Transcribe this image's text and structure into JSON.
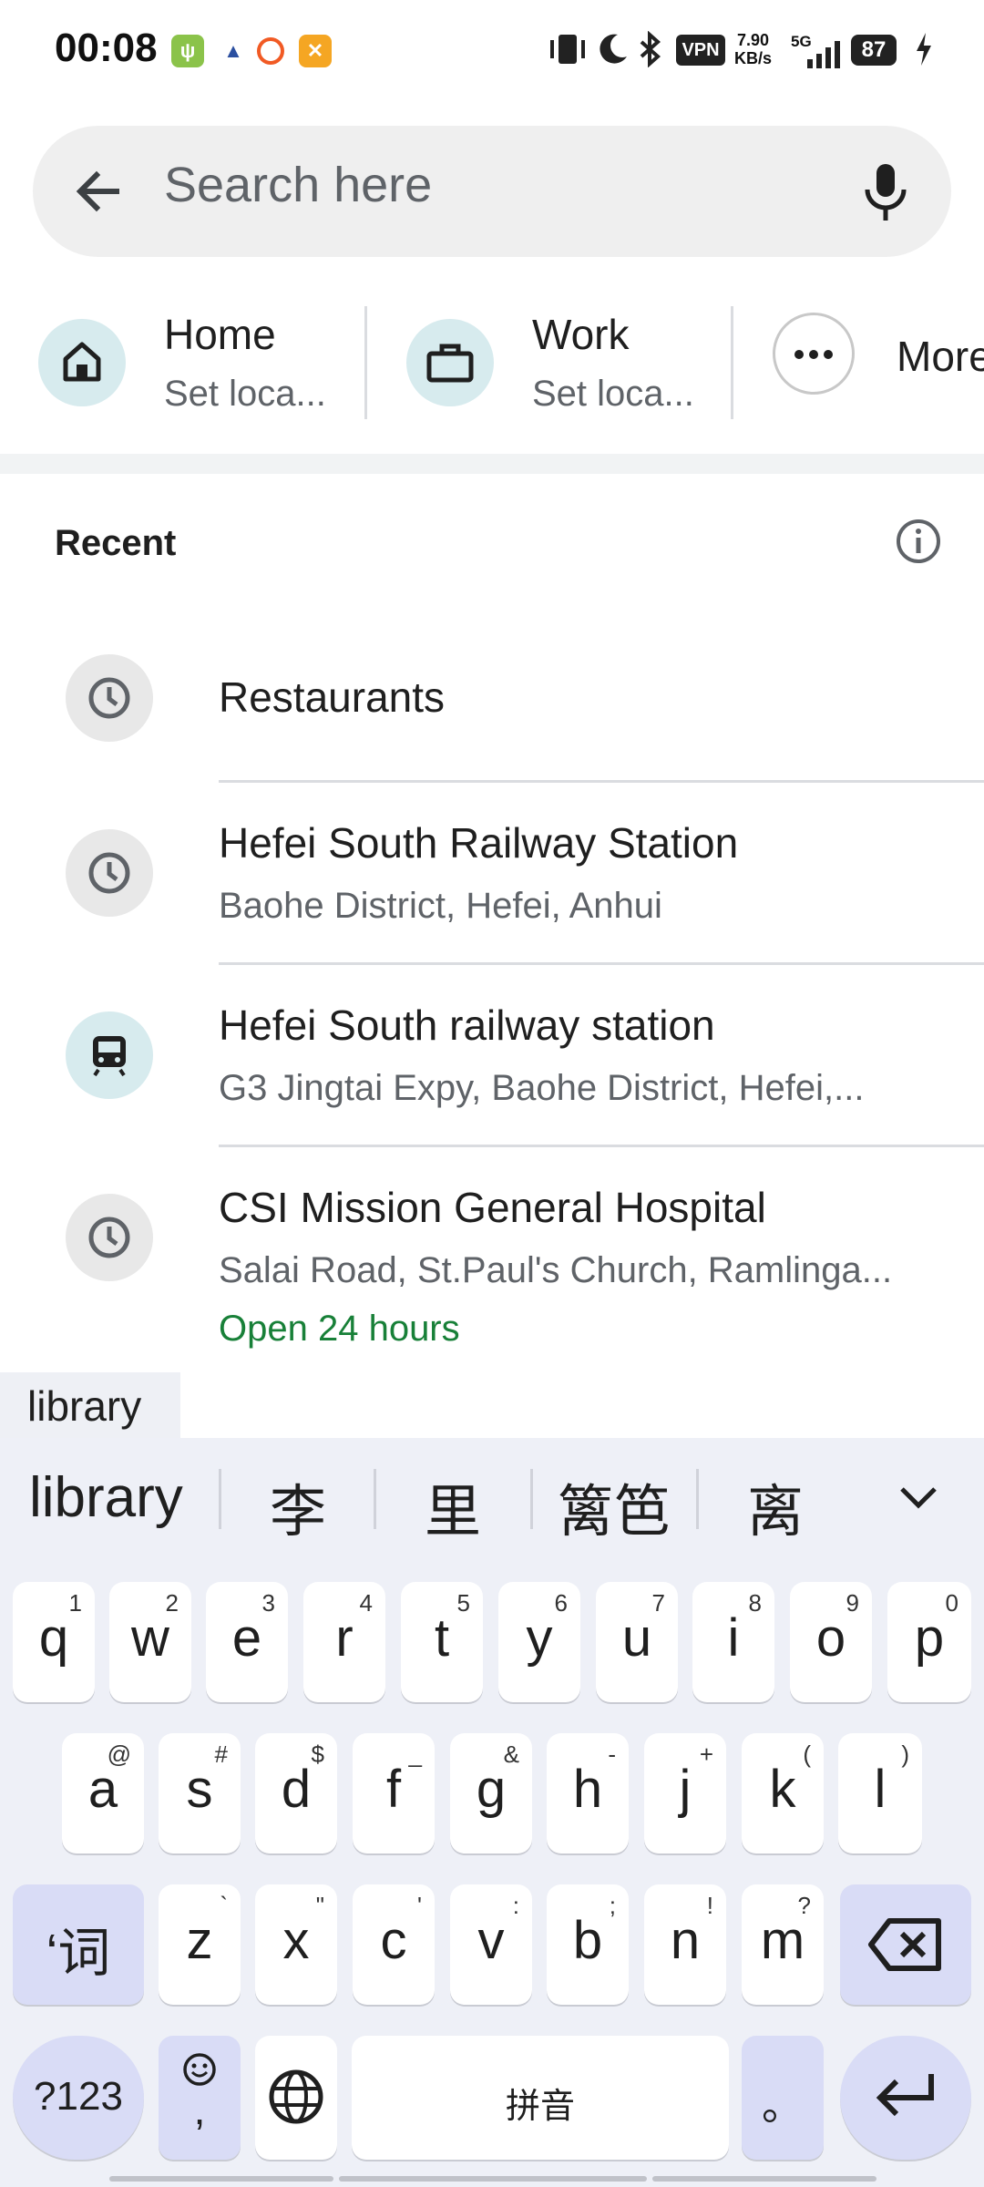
{
  "status_bar": {
    "time": "00:08",
    "vpn": "VPN",
    "speed_value": "7.90",
    "speed_unit": "KB/s",
    "network": "5G",
    "battery": "87"
  },
  "search": {
    "placeholder": "Search here"
  },
  "shortcuts": [
    {
      "label": "Home",
      "sub": "Set loca..."
    },
    {
      "label": "Work",
      "sub": "Set loca..."
    },
    {
      "label": "More"
    }
  ],
  "recent": {
    "heading": "Recent",
    "items": [
      {
        "title": "Restaurants",
        "icon": "clock-icon"
      },
      {
        "title": "Hefei South Railway Station",
        "subtitle": "Baohe District, Hefei, Anhui",
        "icon": "clock-icon"
      },
      {
        "title": "Hefei South railway station",
        "subtitle": "G3 Jingtai Expy, Baohe District, Hefei,...",
        "icon": "train-icon"
      },
      {
        "title": "CSI Mission General Hospital",
        "subtitle": "Salai Road, St.Paul's Church, Ramlinga...",
        "status": "Open 24 hours",
        "icon": "clock-icon"
      }
    ]
  },
  "suggestion_chip": "library",
  "keyboard": {
    "candidates": [
      "library",
      "李",
      "里",
      "篱笆",
      "离"
    ],
    "row1": [
      {
        "key": "q",
        "hint": "1"
      },
      {
        "key": "w",
        "hint": "2"
      },
      {
        "key": "e",
        "hint": "3"
      },
      {
        "key": "r",
        "hint": "4"
      },
      {
        "key": "t",
        "hint": "5"
      },
      {
        "key": "y",
        "hint": "6"
      },
      {
        "key": "u",
        "hint": "7"
      },
      {
        "key": "i",
        "hint": "8"
      },
      {
        "key": "o",
        "hint": "9"
      },
      {
        "key": "p",
        "hint": "0"
      }
    ],
    "row2": [
      {
        "key": "a",
        "hint": "@"
      },
      {
        "key": "s",
        "hint": "#"
      },
      {
        "key": "d",
        "hint": "$"
      },
      {
        "key": "f",
        "hint": "_"
      },
      {
        "key": "g",
        "hint": "&"
      },
      {
        "key": "h",
        "hint": "-"
      },
      {
        "key": "j",
        "hint": "+"
      },
      {
        "key": "k",
        "hint": "("
      },
      {
        "key": "l",
        "hint": ")"
      }
    ],
    "row3": [
      {
        "key": "z",
        "hint": "`"
      },
      {
        "key": "x",
        "hint": "\""
      },
      {
        "key": "c",
        "hint": "'"
      },
      {
        "key": "v",
        "hint": ":"
      },
      {
        "key": "b",
        "hint": ";"
      },
      {
        "key": "n",
        "hint": "!"
      },
      {
        "key": "m",
        "hint": "?"
      }
    ],
    "switch_label": "‘词",
    "numbers_label": "?123",
    "emoji_comma": ",",
    "space_label": "拼音",
    "period_label": "。"
  },
  "colors": {
    "accent_blue": "#1a73e8",
    "open_green": "#188038",
    "shortcut_circle": "#d7ebee"
  }
}
